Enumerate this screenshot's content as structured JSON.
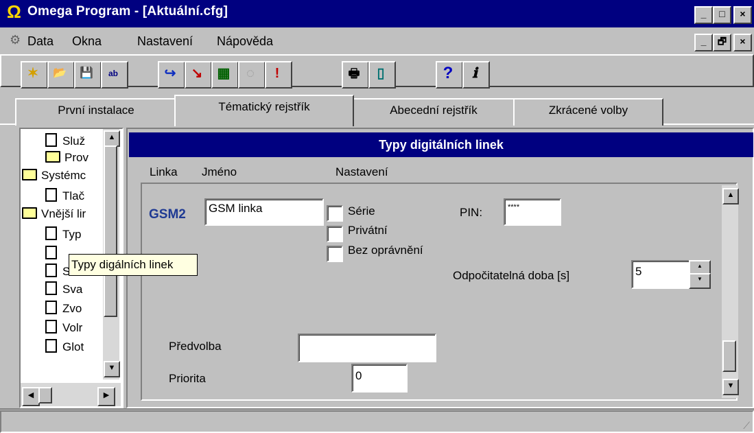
{
  "window": {
    "title": "Omega Program - [Aktuální.cfg]",
    "app_icon": "Ω",
    "caption_buttons": [
      "_",
      "□",
      "×"
    ]
  },
  "menu": {
    "items": [
      "Data",
      "Okna",
      "Nastavení",
      "Nápověda"
    ],
    "mdi_buttons": [
      "_",
      "🗗",
      "×"
    ]
  },
  "toolbar": {
    "buttons": [
      {
        "name": "new-icon",
        "glyph": "✶"
      },
      {
        "name": "open-folder-icon",
        "glyph": "📂"
      },
      {
        "name": "save-icon",
        "glyph": "💾"
      },
      {
        "name": "save-as-icon",
        "glyph": "ab"
      },
      {
        "name": "connect-icon",
        "glyph": "↪"
      },
      {
        "name": "download-icon",
        "glyph": "↘"
      },
      {
        "name": "module-icon",
        "glyph": "▦"
      },
      {
        "name": "disabled-icon",
        "glyph": "◌"
      },
      {
        "name": "alert-icon",
        "glyph": "!"
      },
      {
        "name": "print-icon",
        "glyph": "🖶"
      },
      {
        "name": "door-icon",
        "glyph": "▯"
      },
      {
        "name": "help-icon",
        "glyph": "?"
      },
      {
        "name": "info-icon",
        "glyph": "ℹ"
      }
    ]
  },
  "tabs": [
    "První instalace",
    "Tématický rejstřík",
    "Abecední rejstřík",
    "Zkrácené volby"
  ],
  "tree": {
    "items": [
      {
        "label": "Služ",
        "type": "doc",
        "indent": 1
      },
      {
        "label": "Prov",
        "type": "folder",
        "indent": 1
      },
      {
        "label": "Systémc",
        "type": "folder-open",
        "indent": 0
      },
      {
        "label": "Tlač",
        "type": "doc",
        "indent": 1
      },
      {
        "label": "Vnější lir",
        "type": "folder-open",
        "indent": 0
      },
      {
        "label": "Typ",
        "type": "doc",
        "indent": 1
      },
      {
        "label": "",
        "type": "doc",
        "indent": 1
      },
      {
        "label": "Sva",
        "type": "doc",
        "indent": 1
      },
      {
        "label": "Sva",
        "type": "doc",
        "indent": 1
      },
      {
        "label": "Zvo",
        "type": "doc",
        "indent": 1
      },
      {
        "label": "Volr",
        "type": "doc",
        "indent": 1
      },
      {
        "label": "Glot",
        "type": "doc",
        "indent": 1
      }
    ],
    "tooltip": "Typy digálních linek"
  },
  "panel": {
    "title": "Typy digitálních linek",
    "columns": [
      "Linka",
      "Jméno",
      "Nastavení"
    ],
    "line_id": "GSM2",
    "line_name": "GSM linka",
    "options": [
      "Série",
      "Privátní",
      "Bez oprávnění"
    ],
    "pin_label": "PIN:",
    "pin_value": "****",
    "countdown_label": "Odpočitatelná doba [s]",
    "countdown_value": "5",
    "prefix_label": "Předvolba",
    "prefix_value": "",
    "priority_label": "Priorita",
    "priority_value": "0"
  },
  "colors": {
    "titlebar": "#000080",
    "line_id": "#1f3a93",
    "tooltip_bg": "#ffffe1"
  }
}
